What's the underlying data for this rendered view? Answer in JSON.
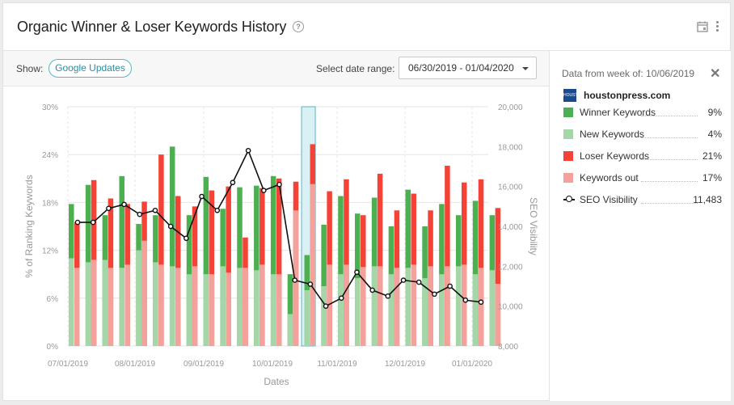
{
  "header": {
    "title": "Organic Winner & Loser Keywords History",
    "help_icon": "?"
  },
  "toolbar": {
    "show_label": "Show:",
    "google_updates_label": "Google Updates",
    "date_range_label": "Select date range:",
    "date_range_value": "06/30/2019 - 01/04/2020"
  },
  "side": {
    "data_week_label": "Data from week of: 10/06/2019",
    "site_logo_text": "HOUSTON PRESS",
    "site_name": "houstonpress.com",
    "legend": [
      {
        "name": "Winner Keywords",
        "value": "9%",
        "color": "#4caf50"
      },
      {
        "name": "New Keywords",
        "value": "4%",
        "color": "#a5d6a7"
      },
      {
        "name": "Loser Keywords",
        "value": "21%",
        "color": "#f44336"
      },
      {
        "name": "Keywords out",
        "value": "17%",
        "color": "#f4a19b"
      },
      {
        "name": "SEO Visibility",
        "value": "11,483",
        "color": "#111111"
      }
    ]
  },
  "chart_data": {
    "type": "bar",
    "xlabel": "Dates",
    "ylabel": "% of Ranking Keywords",
    "y2label": "SEO Visibility",
    "ylim": [
      0,
      30
    ],
    "y_ticks": [
      "0%",
      "6%",
      "12%",
      "18%",
      "24%",
      "30%"
    ],
    "y2lim": [
      8000,
      20000
    ],
    "y2_ticks": [
      "8,000",
      "10,000",
      "12,000",
      "14,000",
      "16,000",
      "18,000",
      "20,000"
    ],
    "x_ticks": [
      "07/01/2019",
      "08/01/2019",
      "09/01/2019",
      "10/01/2019",
      "11/01/2019",
      "12/01/2019",
      "01/01/2020"
    ],
    "highlight_week": "10/06/2019",
    "highlight_index": 14,
    "series": [
      {
        "name": "Winner Keywords",
        "values": [
          17.8,
          20.2,
          16.4,
          21.3,
          15.3,
          16.4,
          25.0,
          16.4,
          21.2,
          17.2,
          19.9,
          20.1,
          21.3,
          9.0,
          11.4,
          15.2,
          18.8,
          16.6,
          18.6,
          15.0,
          19.6,
          15.0,
          17.8,
          16.4,
          18.2,
          16.4
        ]
      },
      {
        "name": "New Keywords",
        "values": [
          11.0,
          10.5,
          10.8,
          9.8,
          12.0,
          10.5,
          10.0,
          9.0,
          9.0,
          10.0,
          9.8,
          9.5,
          9.0,
          4.0,
          7.0,
          7.5,
          9.0,
          8.5,
          10.0,
          9.0,
          9.8,
          8.5,
          9.0,
          10.0,
          9.0,
          9.5
        ]
      },
      {
        "name": "Loser Keywords",
        "values": [
          15.5,
          20.8,
          18.5,
          17.8,
          18.1,
          24.0,
          18.8,
          17.5,
          19.5,
          20.0,
          13.6,
          19.8,
          21.0,
          20.6,
          25.3,
          19.4,
          20.9,
          16.4,
          21.6,
          17.0,
          19.1,
          17.0,
          22.6,
          20.5,
          20.9,
          17.3
        ]
      },
      {
        "name": "Keywords out",
        "values": [
          9.8,
          10.8,
          9.8,
          10.2,
          13.2,
          10.2,
          9.8,
          10.0,
          9.0,
          9.2,
          9.8,
          10.2,
          9.0,
          17.0,
          20.3,
          10.2,
          10.2,
          9.9,
          10.0,
          9.8,
          10.2,
          10.0,
          10.0,
          10.2,
          9.8,
          7.8
        ]
      },
      {
        "name": "SEO Visibility",
        "values": [
          14.2,
          14.2,
          14.9,
          15.1,
          14.6,
          14.8,
          14.0,
          13.4,
          15.5,
          14.8,
          16.2,
          17.8,
          15.8,
          16.1,
          11.3,
          11.1,
          10.0,
          10.4,
          11.7,
          10.8,
          10.5,
          11.3,
          11.2,
          10.6,
          11.0,
          10.3,
          10.2
        ]
      }
    ]
  }
}
